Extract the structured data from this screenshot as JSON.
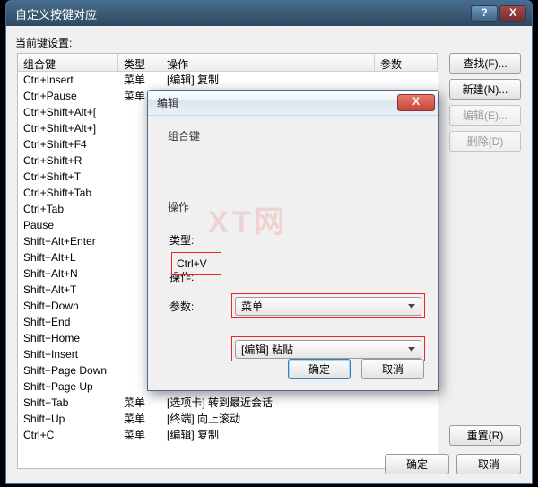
{
  "main": {
    "title": "自定义按键对应",
    "help_mark": "?",
    "close_mark": "X",
    "current_label": "当前键设置:",
    "cols": [
      "组合键",
      "类型",
      "操作",
      "参数"
    ],
    "rows": [
      {
        "key": "Ctrl+Insert",
        "type": "菜单",
        "op": "[编辑] 复制"
      },
      {
        "key": "Ctrl+Pause",
        "type": "菜单",
        "op": ""
      },
      {
        "key": "Ctrl+Shift+Alt+[",
        "type": "",
        "op": ""
      },
      {
        "key": "Ctrl+Shift+Alt+]",
        "type": "",
        "op": ""
      },
      {
        "key": "Ctrl+Shift+F4",
        "type": "",
        "op": ""
      },
      {
        "key": "Ctrl+Shift+R",
        "type": "",
        "op": ""
      },
      {
        "key": "Ctrl+Shift+T",
        "type": "",
        "op": ""
      },
      {
        "key": "Ctrl+Shift+Tab",
        "type": "",
        "op": ""
      },
      {
        "key": "Ctrl+Tab",
        "type": "",
        "op": ""
      },
      {
        "key": "Pause",
        "type": "",
        "op": ""
      },
      {
        "key": "Shift+Alt+Enter",
        "type": "",
        "op": ""
      },
      {
        "key": "Shift+Alt+L",
        "type": "",
        "op": ""
      },
      {
        "key": "Shift+Alt+N",
        "type": "",
        "op": ""
      },
      {
        "key": "Shift+Alt+T",
        "type": "",
        "op": ""
      },
      {
        "key": "Shift+Down",
        "type": "",
        "op": ""
      },
      {
        "key": "Shift+End",
        "type": "",
        "op": ""
      },
      {
        "key": "Shift+Home",
        "type": "",
        "op": ""
      },
      {
        "key": "Shift+Insert",
        "type": "",
        "op": ""
      },
      {
        "key": "Shift+Page Down",
        "type": "",
        "op": ""
      },
      {
        "key": "Shift+Page Up",
        "type": "",
        "op": ""
      },
      {
        "key": "Shift+Tab",
        "type": "菜单",
        "op": "[选项卡] 转到最近会话"
      },
      {
        "key": "Shift+Up",
        "type": "菜单",
        "op": "[终端] 向上滚动"
      },
      {
        "key": "Ctrl+C",
        "type": "菜单",
        "op": "[编辑] 复制"
      }
    ],
    "side": {
      "find": "查找(F)...",
      "new": "新建(N)...",
      "edit": "编辑(E)...",
      "delete": "删除(D)"
    },
    "reset": "重置(R)",
    "ok": "确定",
    "cancel": "取消"
  },
  "dlg": {
    "title": "编辑",
    "close_mark": "X",
    "group_combo": "组合键",
    "combo_value": "Ctrl+V",
    "group_op": "操作",
    "type_label": "类型:",
    "type_value": "菜单",
    "op_label": "操作:",
    "op_value": "[编辑] 粘贴",
    "param_label": "参数:",
    "ok": "确定",
    "cancel": "取消"
  },
  "watermark": "XT网"
}
